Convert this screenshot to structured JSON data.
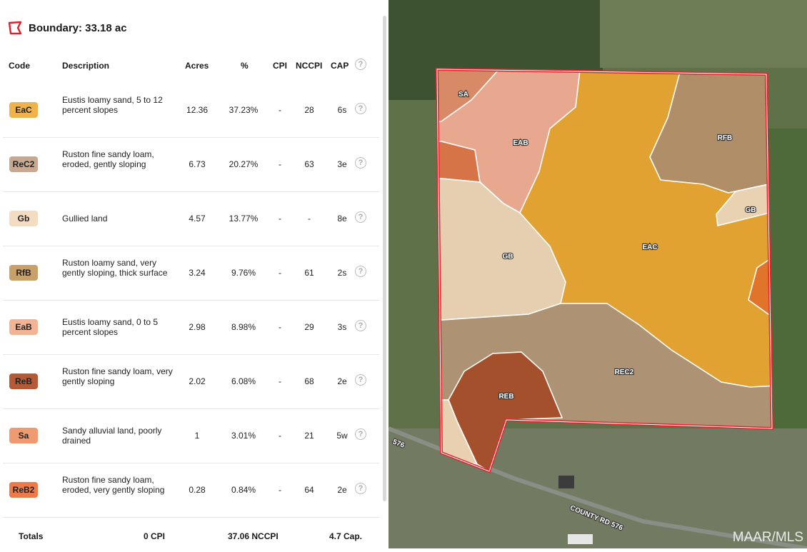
{
  "boundary": {
    "title": "Boundary: 33.18 ac",
    "icon": "boundary-polygon-icon"
  },
  "columns": {
    "code": "Code",
    "description": "Description",
    "acres": "Acres",
    "pct": "%",
    "cpi": "CPI",
    "nccpi": "NCCPI",
    "cap": "CAP",
    "help": "?"
  },
  "rows": [
    {
      "code": "EaC",
      "description": "Eustis loamy sand, 5 to 12 percent slopes",
      "acres": "12.36",
      "pct": "37.23%",
      "cpi": "-",
      "nccpi": "28",
      "cap": "6s",
      "color": "#f0b24a"
    },
    {
      "code": "ReC2",
      "description": "Ruston fine sandy loam, eroded, gently sloping",
      "acres": "6.73",
      "pct": "20.27%",
      "cpi": "-",
      "nccpi": "63",
      "cap": "3e",
      "color": "#c8a890"
    },
    {
      "code": "Gb",
      "description": "Gullied land",
      "acres": "4.57",
      "pct": "13.77%",
      "cpi": "-",
      "nccpi": "-",
      "cap": "8e",
      "color": "#f4dcc2"
    },
    {
      "code": "RfB",
      "description": "Ruston loamy sand, very gently sloping, thick surface",
      "acres": "3.24",
      "pct": "9.76%",
      "cpi": "-",
      "nccpi": "61",
      "cap": "2s",
      "color": "#c8a06a"
    },
    {
      "code": "EaB",
      "description": "Eustis loamy sand, 0 to 5 percent slopes",
      "acres": "2.98",
      "pct": "8.98%",
      "cpi": "-",
      "nccpi": "29",
      "cap": "3s",
      "color": "#f2b494"
    },
    {
      "code": "ReB",
      "description": "Ruston fine sandy loam, very gently sloping",
      "acres": "2.02",
      "pct": "6.08%",
      "cpi": "-",
      "nccpi": "68",
      "cap": "2e",
      "color": "#b45a36"
    },
    {
      "code": "Sa",
      "description": "Sandy alluvial land, poorly drained",
      "acres": "1",
      "pct": "3.01%",
      "cpi": "-",
      "nccpi": "21",
      "cap": "5w",
      "color": "#ef9a70"
    },
    {
      "code": "ReB2",
      "description": "Ruston fine sandy loam, eroded, very gently sloping",
      "acres": "0.28",
      "pct": "0.84%",
      "cpi": "-",
      "nccpi": "64",
      "cap": "2e",
      "color": "#ec7a4a"
    }
  ],
  "totals": {
    "label": "Totals",
    "cpi": "0 CPI",
    "nccpi": "37.06 NCCPI",
    "cap": "4.7 Cap."
  },
  "map": {
    "labels": {
      "sa": "SA",
      "eab": "EAB",
      "rfb": "RFB",
      "gb_small": "GB",
      "gb": "GB",
      "eac": "EAC",
      "rec2": "REC2",
      "reb": "REB"
    },
    "road": "COUNTY RD 576",
    "road_short": "576",
    "watermark": "MAAR/MLS"
  }
}
